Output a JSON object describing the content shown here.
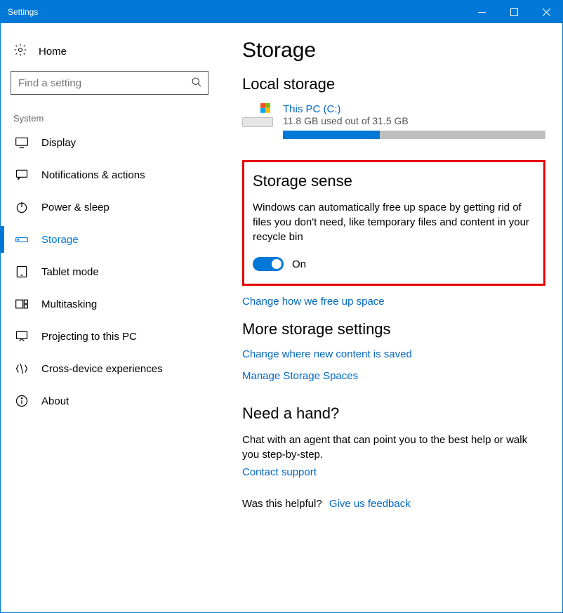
{
  "window": {
    "title": "Settings"
  },
  "sidebar": {
    "home": "Home",
    "search_placeholder": "Find a setting",
    "section_label": "System",
    "items": [
      {
        "label": "Display"
      },
      {
        "label": "Notifications & actions"
      },
      {
        "label": "Power & sleep"
      },
      {
        "label": "Storage"
      },
      {
        "label": "Tablet mode"
      },
      {
        "label": "Multitasking"
      },
      {
        "label": "Projecting to this PC"
      },
      {
        "label": "Cross-device experiences"
      },
      {
        "label": "About"
      }
    ]
  },
  "main": {
    "title": "Storage",
    "local_storage_heading": "Local storage",
    "drive": {
      "name": "This PC (C:)",
      "usage_text": "11.8 GB used out of 31.5 GB",
      "used_gb": 11.8,
      "total_gb": 31.5,
      "fill_percent": 37
    },
    "storage_sense": {
      "heading": "Storage sense",
      "description": "Windows can automatically free up space by getting rid of files you don't need, like temporary files and content in your recycle bin",
      "toggle_state": "On",
      "toggle_on": true
    },
    "change_free_up": "Change how we free up space",
    "more_heading": "More storage settings",
    "change_new_content": "Change where new content is saved",
    "manage_spaces": "Manage Storage Spaces",
    "help_heading": "Need a hand?",
    "help_text": "Chat with an agent that can point you to the best help or walk you step-by-step.",
    "contact_support": "Contact support",
    "feedback_q": "Was this helpful?",
    "feedback_link": "Give us feedback"
  }
}
